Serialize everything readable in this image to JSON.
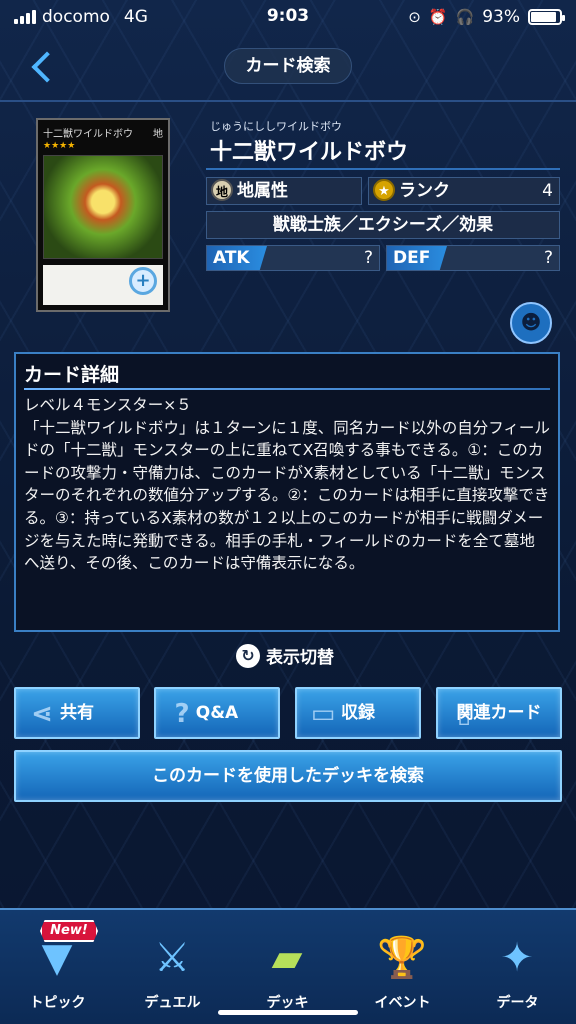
{
  "status_bar": {
    "carrier": "docomo",
    "network": "4G",
    "time": "9:03",
    "battery": "93%"
  },
  "header": {
    "title": "カード検索"
  },
  "card": {
    "image_name": "十二獣ワイルドボウ",
    "image_attribute": "地",
    "reading": "じゅうにししワイルドボウ",
    "name": "十二獣ワイルドボウ",
    "attribute_icon": "地",
    "attribute": "地属性",
    "rank_label": "ランク",
    "rank": "4",
    "type": "獣戦士族／エクシーズ／効果",
    "atk_label": "ATK",
    "atk": "?",
    "def_label": "DEF",
    "def": "?"
  },
  "detail": {
    "title": "カード詳細",
    "text": "レベル４モンスター×５\n「十二獣ワイルドボウ」は１ターンに１度、同名カード以外の自分フィールドの「十二獣」モンスターの上に重ねてX召喚する事もできる。①：このカードの攻撃力・守備力は、このカードがX素材としている「十二獣」モンスターのそれぞれの数値分アップする。②：このカードは相手に直接攻撃できる。③：持っているX素材の数が１２以上のこのカードが相手に戦闘ダメージを与えた時に発動できる。相手の手札・フィールドのカードを全て墓地へ送り、その後、このカードは守備表示になる。"
  },
  "toggle_label": "表示切替",
  "buttons": {
    "share": "共有",
    "qa": "Q&A",
    "recorded": "収録",
    "related": "関連カード",
    "deck_search": "このカードを使用したデッキを検索"
  },
  "tabs": [
    {
      "label": "トピック",
      "badge": "New!"
    },
    {
      "label": "デュエル"
    },
    {
      "label": "デッキ"
    },
    {
      "label": "イベント"
    },
    {
      "label": "データ"
    }
  ]
}
